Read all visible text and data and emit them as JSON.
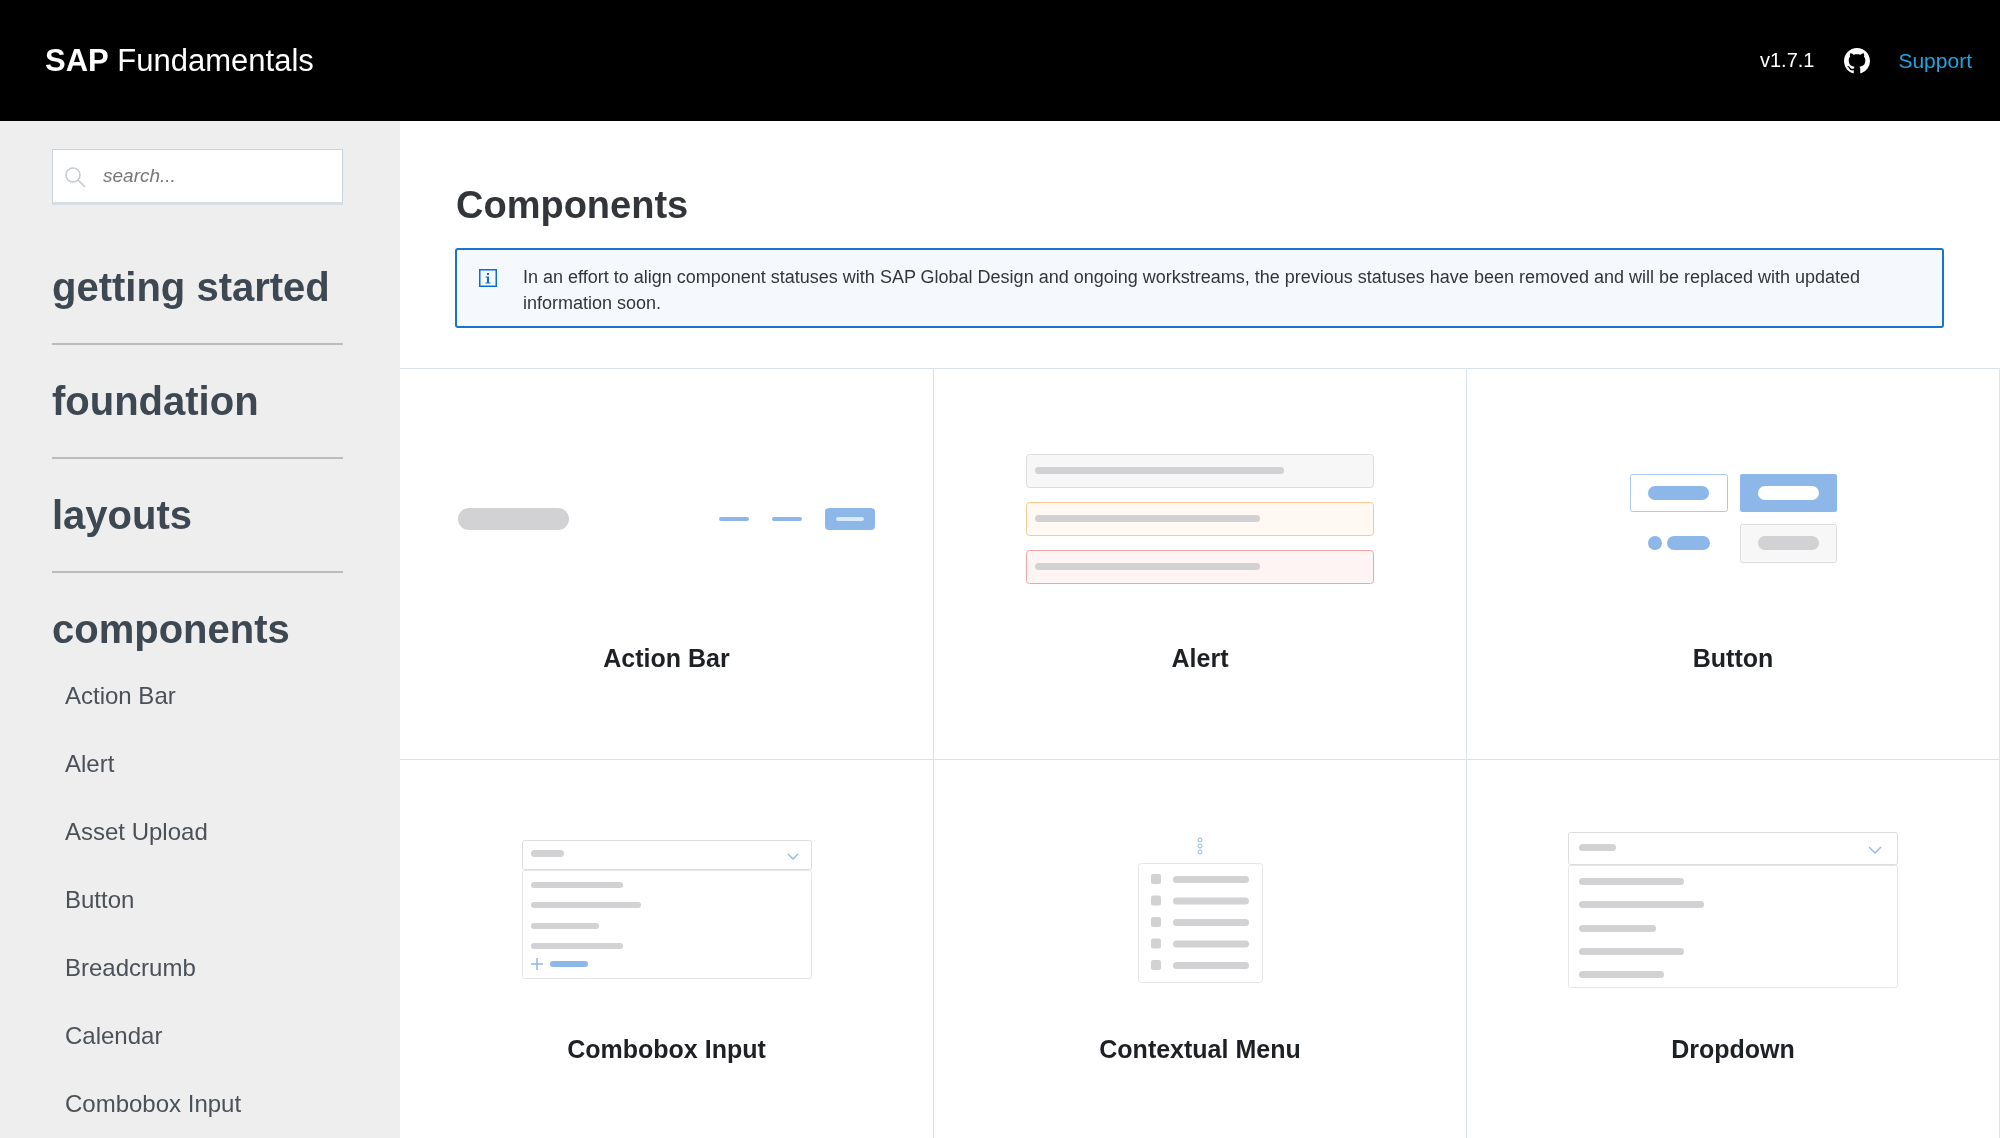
{
  "header": {
    "logo": "**SAP** Fundamentals",
    "version": "v1.7.1",
    "support_link": "Support"
  },
  "sidebar": {
    "search": {
      "placeholder": "search..."
    },
    "sections": [
      {
        "title": "getting started"
      },
      {
        "title": "foundation"
      },
      {
        "title": "layouts"
      },
      {
        "title": "components",
        "items": [
          "Action Bar",
          "Alert",
          "Asset Upload",
          "Button",
          "Breadcrumb",
          "Calendar",
          "Combobox Input"
        ]
      }
    ]
  },
  "main": {
    "title": "Components",
    "notice": "In an effort to align component statuses with SAP Global Design and ongoing workstreams, the previous statuses have been removed and will be replaced with updated information soon.",
    "cards": [
      {
        "kind": "action-bar",
        "title": "Action Bar"
      },
      {
        "kind": "alert",
        "title": "Alert"
      },
      {
        "kind": "button",
        "title": "Button"
      },
      {
        "kind": "combobox",
        "title": "Combobox Input"
      },
      {
        "kind": "contextual-menu",
        "title": "Contextual Menu"
      },
      {
        "kind": "dropdown",
        "title": "Dropdown"
      }
    ]
  }
}
